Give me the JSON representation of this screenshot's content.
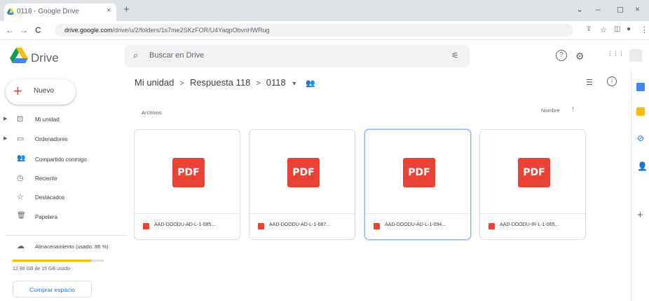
{
  "browser": {
    "tab_title": "0118 - Google Drive",
    "tab_close": "×",
    "new_tab": "+",
    "url_host": "drive.google.com",
    "url_path": "/drive/u/2/folders/1s7me2SKzFOR/U4YaqpObvnHWRug",
    "nav_back": "←",
    "nav_forward": "→",
    "nav_reload": "C",
    "window_controls": [
      "⌄",
      "–",
      "◻",
      "×"
    ]
  },
  "header": {
    "app_name": "Drive",
    "search_placeholder": "Buscar en Drive",
    "search_options_icon": "⚟",
    "help_icon": "?",
    "settings_icon": "⚙",
    "apps_icon": "⋮⋮⋮"
  },
  "sidebar": {
    "new_button_label": "Nuevo",
    "items": [
      {
        "label": "Mi unidad",
        "icon": "drive-icon",
        "glyph": "⊡",
        "has_arrow": true
      },
      {
        "label": "Ordenadores",
        "icon": "computer-icon",
        "glyph": "▭",
        "has_arrow": true
      },
      {
        "label": "Compartido conmigo",
        "icon": "shared-icon",
        "glyph": "👥",
        "has_arrow": false
      },
      {
        "label": "Reciente",
        "icon": "clock-icon",
        "glyph": "◷",
        "has_arrow": false
      },
      {
        "label": "Destacados",
        "icon": "star-icon",
        "glyph": "☆",
        "has_arrow": false
      },
      {
        "label": "Papelera",
        "icon": "trash-icon",
        "glyph": "🗑",
        "has_arrow": false
      }
    ],
    "storage_label": "Almacenamiento (usado: 86 %)",
    "storage_used_percent": 86,
    "storage_text": "12,98 GB de 15 GB usado",
    "buy_storage_label": "Comprar espacio",
    "storage_color": "#fbbc04"
  },
  "main": {
    "breadcrumb": [
      "Mi unidad",
      "Respuesta 118",
      "0118"
    ],
    "breadcrumb_sep": ">",
    "dropdown_glyph": "▾",
    "section_label": "Archivos",
    "sort_label": "Nombre",
    "sort_arrow": "↑",
    "files": [
      {
        "name": "AAD-DOODU-AD-L-1-085...",
        "badge": "PDF",
        "selected": false
      },
      {
        "name": "AAD-DOODU-AD-L-1-087...",
        "badge": "PDF",
        "selected": false
      },
      {
        "name": "AAD-DOODU-AD-L-1-094...",
        "badge": "PDF",
        "selected": true
      },
      {
        "name": "AAD-DOODU-IR-L-1-065...",
        "badge": "PDF",
        "selected": false
      }
    ]
  },
  "colors": {
    "accent": "#1a73e8",
    "pdf_red": "#ea4335"
  }
}
